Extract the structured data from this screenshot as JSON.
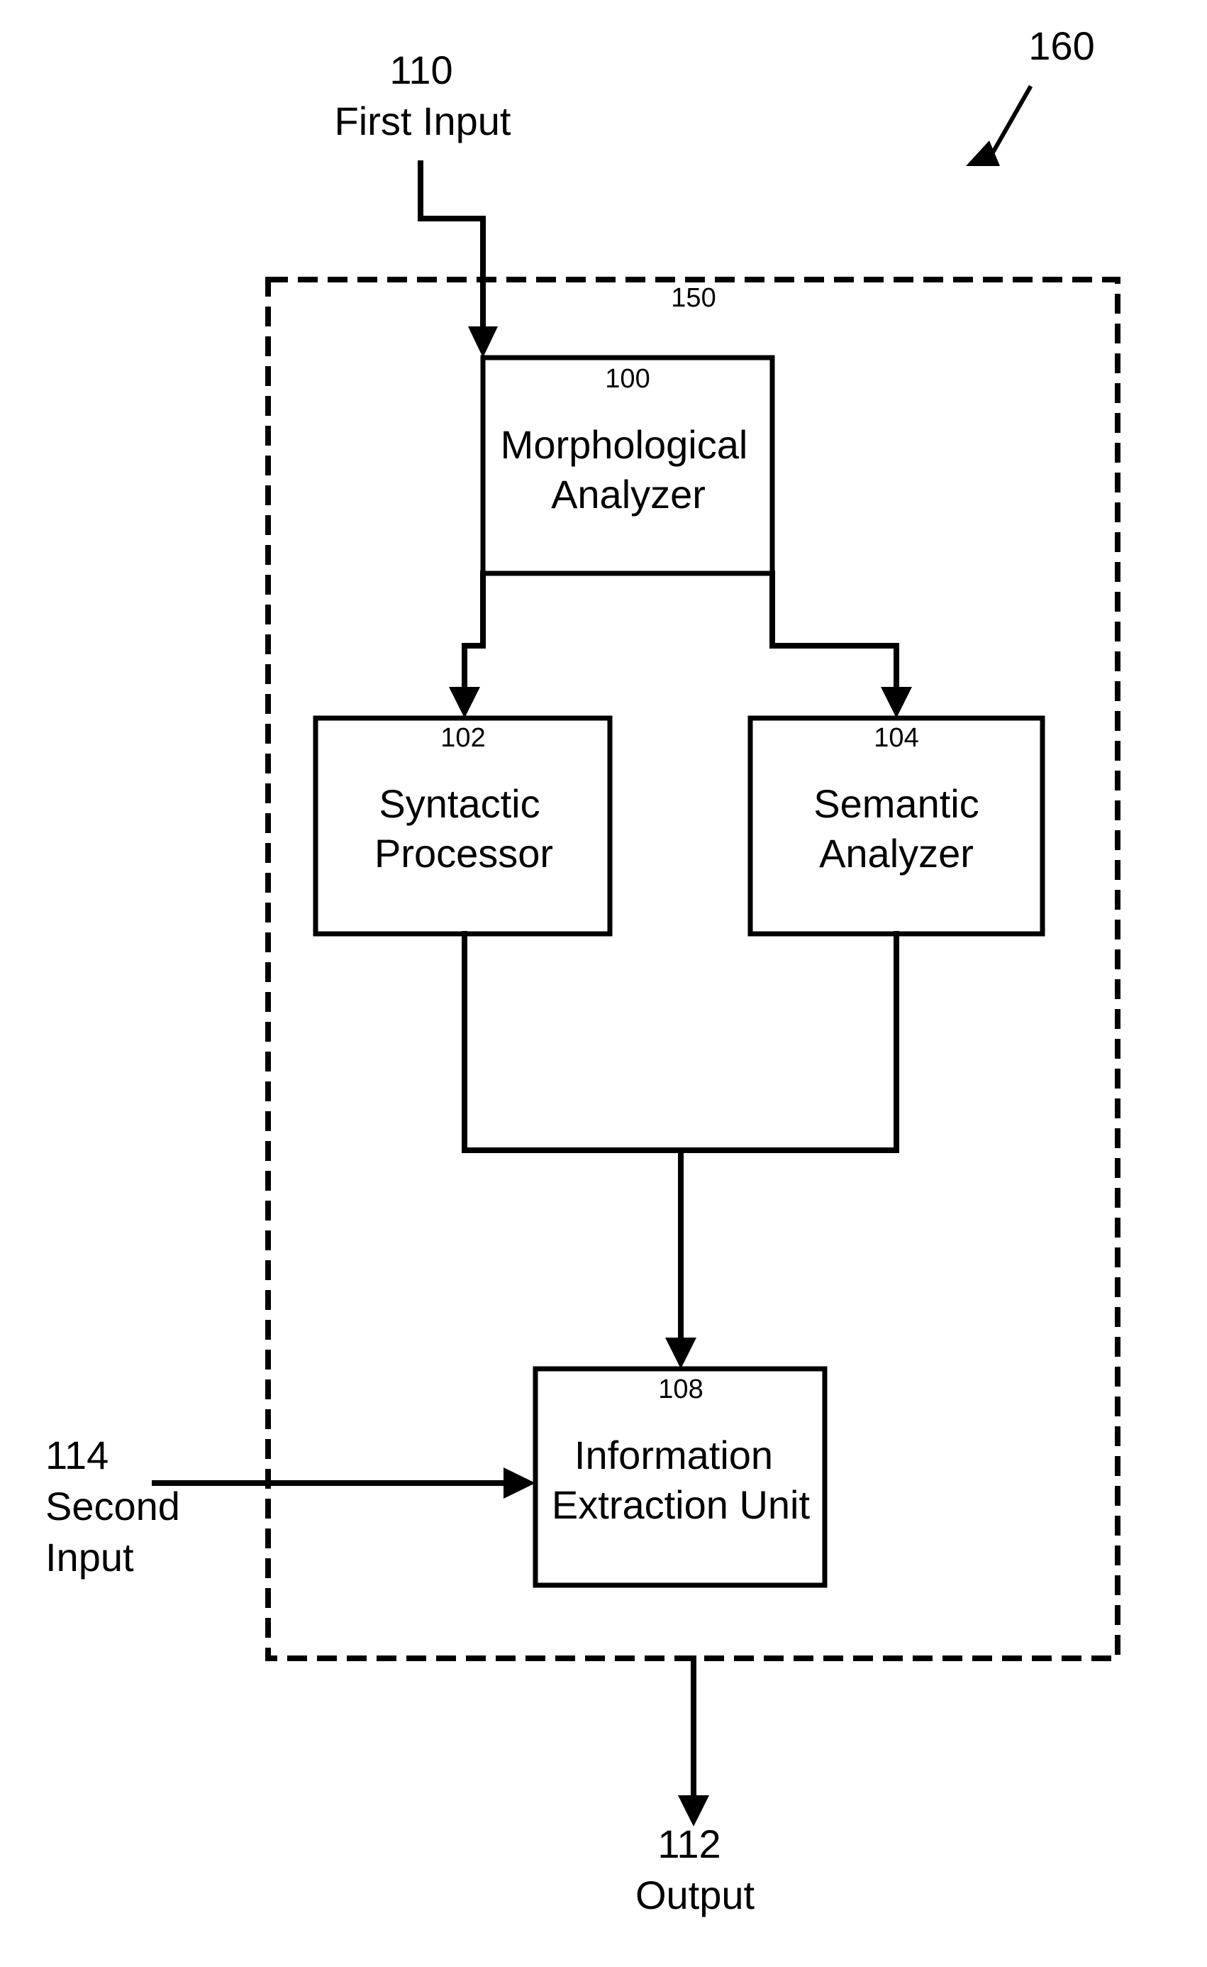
{
  "figure_ref": "160",
  "system_box": {
    "ref": "150"
  },
  "inputs": {
    "first": {
      "ref": "110",
      "label": "First Input"
    },
    "second": {
      "ref": "114",
      "label_line1": "Second",
      "label_line2": "Input"
    }
  },
  "output": {
    "ref": "112",
    "label": "Output"
  },
  "blocks": {
    "morphological": {
      "ref": "100",
      "line1": "Morphological",
      "line2": "Analyzer"
    },
    "syntactic": {
      "ref": "102",
      "line1": "Syntactic",
      "line2": "Processor"
    },
    "semantic": {
      "ref": "104",
      "line1": "Semantic",
      "line2": "Analyzer"
    },
    "extraction": {
      "ref": "108",
      "line1": "Information",
      "line2": "Extraction Unit"
    }
  },
  "connections": [
    {
      "from": "First Input",
      "to": "Morphological Analyzer"
    },
    {
      "from": "Morphological Analyzer",
      "to": "Syntactic Processor"
    },
    {
      "from": "Morphological Analyzer",
      "to": "Semantic Analyzer"
    },
    {
      "from": "Syntactic Processor",
      "to": "Information Extraction Unit"
    },
    {
      "from": "Semantic Analyzer",
      "to": "Information Extraction Unit"
    },
    {
      "from": "Second Input",
      "to": "Information Extraction Unit"
    },
    {
      "from": "Information Extraction Unit",
      "to": "Output"
    }
  ]
}
